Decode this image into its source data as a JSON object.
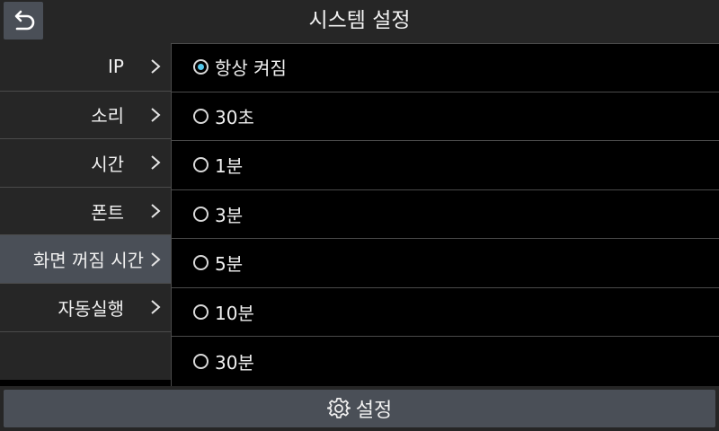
{
  "header": {
    "title": "시스템 설정",
    "back_icon": "back-arrow-icon"
  },
  "sidebar": {
    "items": [
      {
        "label": "IP"
      },
      {
        "label": "소리"
      },
      {
        "label": "시간"
      },
      {
        "label": "폰트"
      },
      {
        "label": "화면 꺼짐 시간",
        "active": true
      },
      {
        "label": "자동실행"
      }
    ],
    "chevron_icon": "chevron-right-icon"
  },
  "options": [
    {
      "label": "항상 켜짐",
      "selected": true
    },
    {
      "label": "30초",
      "selected": false
    },
    {
      "label": "1분",
      "selected": false
    },
    {
      "label": "3분",
      "selected": false
    },
    {
      "label": "5분",
      "selected": false
    },
    {
      "label": "10분",
      "selected": false
    },
    {
      "label": "30분",
      "selected": false
    }
  ],
  "footer": {
    "settings_label": "설정",
    "icon": "gear-icon"
  },
  "colors": {
    "accent": "#55c8ec",
    "panel": "#262626",
    "active": "#4a4f57"
  }
}
